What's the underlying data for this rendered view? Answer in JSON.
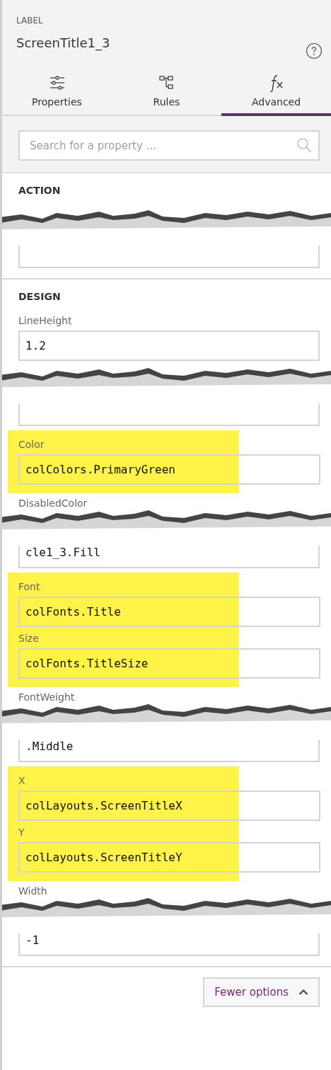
{
  "header": {
    "kind_label": "LABEL",
    "title": "ScreenTitle1_3"
  },
  "tabs": [
    {
      "label": "Properties",
      "kind": "sliders",
      "selected": false
    },
    {
      "label": "Rules",
      "kind": "rules",
      "selected": false
    },
    {
      "label": "Advanced",
      "kind": "fx",
      "selected": true
    }
  ],
  "search": {
    "placeholder": "Search for a property ..."
  },
  "sections": [
    {
      "title": "ACTION",
      "items": [
        {
          "kind": "tear"
        },
        {
          "kind": "cut-field"
        }
      ]
    },
    {
      "title": "DESIGN",
      "items": [
        {
          "kind": "field",
          "label": "LineHeight",
          "value": "1.2"
        },
        {
          "kind": "tear"
        },
        {
          "kind": "cut-field"
        },
        {
          "kind": "highlight",
          "fields": [
            {
              "label": "Color",
              "value": "colColors.PrimaryGreen"
            }
          ]
        },
        {
          "kind": "tear",
          "label": "DisabledColor"
        },
        {
          "kind": "cut-field",
          "value": "cle1_3.Fill"
        },
        {
          "kind": "highlight",
          "fields": [
            {
              "label": "Font",
              "value": "colFonts.Title"
            },
            {
              "label": "Size",
              "value": "colFonts.TitleSize"
            }
          ]
        },
        {
          "kind": "tear",
          "label": "FontWeight"
        },
        {
          "kind": "cut-field",
          "value": ".Middle"
        },
        {
          "kind": "highlight",
          "fields": [
            {
              "label": "X",
              "value": "colLayouts.ScreenTitleX"
            },
            {
              "label": "Y",
              "value": "colLayouts.ScreenTitleY"
            }
          ]
        },
        {
          "kind": "tear",
          "label": "Width"
        },
        {
          "kind": "cut-field",
          "value": "-1"
        }
      ]
    }
  ],
  "footer_button": {
    "label": "Fewer options"
  }
}
